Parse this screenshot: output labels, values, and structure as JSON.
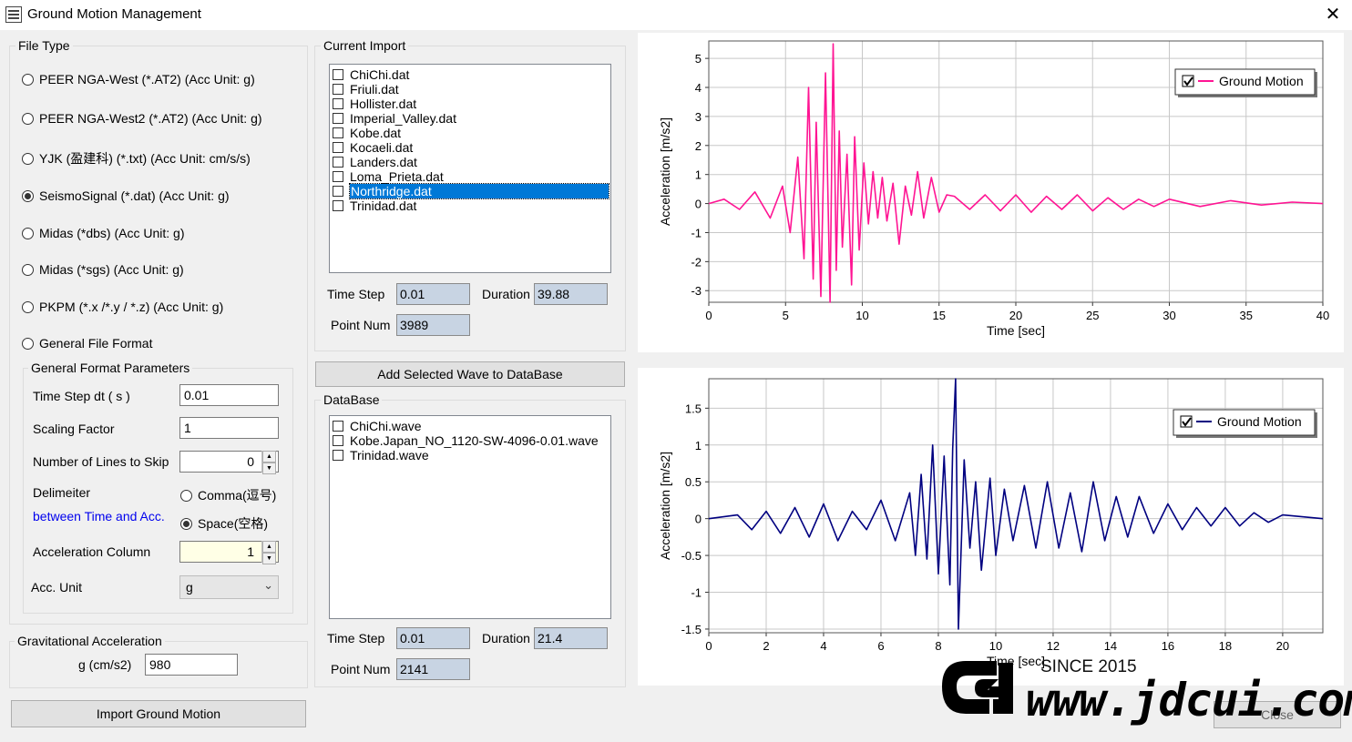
{
  "window": {
    "title": "Ground Motion Management",
    "close_glyph": "✕"
  },
  "file_type": {
    "legend": "File Type",
    "options": [
      {
        "label": "PEER NGA-West (*.AT2) (Acc Unit: g)",
        "checked": false
      },
      {
        "label": "PEER NGA-West2 (*.AT2) (Acc Unit: g)",
        "checked": false
      },
      {
        "label": "YJK (盈建科) (*.txt) (Acc Unit: cm/s/s)",
        "checked": false
      },
      {
        "label": "SeismoSignal (*.dat) (Acc Unit: g)",
        "checked": true
      },
      {
        "label": "Midas (*dbs) (Acc Unit: g)",
        "checked": false
      },
      {
        "label": "Midas (*sgs) (Acc Unit: g)",
        "checked": false
      },
      {
        "label": "PKPM (*.x /*.y / *.z) (Acc Unit: g)",
        "checked": false
      },
      {
        "label": "General File Format",
        "checked": false
      }
    ]
  },
  "general_params": {
    "legend": "General Format Parameters",
    "time_step_label": "Time Step dt ( s )",
    "time_step_value": "0.01",
    "scaling_label": "Scaling Factor",
    "scaling_value": "1",
    "skip_label": "Number of Lines to Skip",
    "skip_value": "0",
    "delimiter_label": "Delimeiter",
    "delimiter_sub": "between Time and Acc.",
    "delimiter_comma": "Comma(逗号)",
    "delimiter_space": "Space(空格)",
    "acc_col_label": "Acceleration Column",
    "acc_col_value": "1",
    "acc_unit_label": "Acc. Unit",
    "acc_unit_value": "g"
  },
  "gravity": {
    "legend": "Gravitational Acceleration",
    "label": "g (cm/s2)",
    "value": "980"
  },
  "import_button": "Import Ground Motion",
  "current_import": {
    "legend": "Current Import",
    "files": [
      "ChiChi.dat",
      "Friuli.dat",
      "Hollister.dat",
      "Imperial_Valley.dat",
      "Kobe.dat",
      "Kocaeli.dat",
      "Landers.dat",
      "Loma_Prieta.dat",
      "Northridge.dat",
      "Trinidad.dat"
    ],
    "selected": "Northridge.dat",
    "time_step_label": "Time Step",
    "time_step": "0.01",
    "duration_label": "Duration",
    "duration": "39.88",
    "point_num_label": "Point Num",
    "point_num": "3989"
  },
  "add_button": "Add Selected Wave to DataBase",
  "database": {
    "legend": "DataBase",
    "files": [
      "ChiChi.wave",
      "Kobe.Japan_NO_1120-SW-4096-0.01.wave",
      "Trinidad.wave"
    ],
    "time_step_label": "Time Step",
    "time_step": "0.01",
    "duration_label": "Duration",
    "duration": "21.4",
    "point_num_label": "Point Num",
    "point_num": "2141"
  },
  "close_button": "Close",
  "watermark": {
    "since": "SINCE 2015",
    "url": "www.jdcui.com"
  },
  "chart_data": [
    {
      "type": "line",
      "xlabel": "Time [sec]",
      "ylabel": "Acceleration [m/s2]",
      "xlim": [
        0,
        40
      ],
      "ylim": [
        -3.4,
        5.6
      ],
      "xticks": [
        0,
        5,
        10,
        15,
        20,
        25,
        30,
        35,
        40
      ],
      "yticks": [
        -3,
        -2,
        -1,
        0,
        1,
        2,
        3,
        4,
        5
      ],
      "grid": true,
      "legend": "top-right",
      "series": [
        {
          "name": "Ground Motion",
          "color": "#ff1493",
          "x": [
            0,
            1,
            2,
            3,
            4,
            4.8,
            5.3,
            5.8,
            6.2,
            6.5,
            6.8,
            7.0,
            7.3,
            7.6,
            7.9,
            8.1,
            8.3,
            8.5,
            8.7,
            9.0,
            9.3,
            9.5,
            9.8,
            10.1,
            10.4,
            10.7,
            11.0,
            11.3,
            11.6,
            12.0,
            12.4,
            12.8,
            13.2,
            13.6,
            14.0,
            14.5,
            15.0,
            15.5,
            16,
            17,
            18,
            19,
            20,
            21,
            22,
            23,
            24,
            25,
            26,
            27,
            28,
            29,
            30,
            32,
            34,
            36,
            38,
            40
          ],
          "y": [
            0,
            0.15,
            -0.2,
            0.4,
            -0.5,
            0.6,
            -1.0,
            1.6,
            -1.9,
            4.0,
            -2.6,
            2.8,
            -3.2,
            4.5,
            -3.4,
            5.5,
            -2.3,
            2.5,
            -1.5,
            1.7,
            -2.8,
            2.3,
            -1.6,
            1.4,
            -0.7,
            1.1,
            -0.5,
            0.9,
            -0.6,
            0.7,
            -1.4,
            0.6,
            -0.4,
            1.1,
            -0.5,
            0.9,
            -0.3,
            0.3,
            0.25,
            -0.2,
            0.3,
            -0.25,
            0.3,
            -0.3,
            0.25,
            -0.2,
            0.3,
            -0.25,
            0.2,
            -0.2,
            0.15,
            -0.1,
            0.15,
            -0.1,
            0.1,
            -0.05,
            0.05,
            0
          ]
        }
      ]
    },
    {
      "type": "line",
      "xlabel": "Time [sec]",
      "ylabel": "Acceleration [m/s2]",
      "xlim": [
        0,
        21.4
      ],
      "ylim": [
        -1.55,
        1.9
      ],
      "xticks": [
        0,
        2,
        4,
        6,
        8,
        10,
        12,
        14,
        16,
        18,
        20
      ],
      "yticks": [
        -1.5,
        -1,
        -0.5,
        0,
        0.5,
        1,
        1.5
      ],
      "grid": true,
      "legend": "top-right",
      "series": [
        {
          "name": "Ground Motion",
          "color": "#000080",
          "x": [
            0,
            1,
            1.5,
            2,
            2.5,
            3,
            3.5,
            4,
            4.5,
            5,
            5.5,
            6,
            6.5,
            7.0,
            7.2,
            7.4,
            7.6,
            7.8,
            8.0,
            8.2,
            8.4,
            8.5,
            8.6,
            8.7,
            8.9,
            9.1,
            9.3,
            9.5,
            9.8,
            10.0,
            10.3,
            10.6,
            11.0,
            11.4,
            11.8,
            12.2,
            12.6,
            13.0,
            13.4,
            13.8,
            14.2,
            14.6,
            15.0,
            15.5,
            16,
            16.5,
            17,
            17.5,
            18,
            18.5,
            19,
            19.5,
            20,
            21.4
          ],
          "y": [
            0,
            0.05,
            -0.15,
            0.1,
            -0.2,
            0.15,
            -0.25,
            0.2,
            -0.3,
            0.1,
            -0.15,
            0.25,
            -0.3,
            0.35,
            -0.5,
            0.6,
            -0.55,
            1.0,
            -0.75,
            0.85,
            -0.9,
            0.95,
            1.9,
            -1.5,
            0.8,
            -0.4,
            0.5,
            -0.7,
            0.55,
            -0.5,
            0.4,
            -0.3,
            0.45,
            -0.4,
            0.5,
            -0.4,
            0.35,
            -0.45,
            0.5,
            -0.3,
            0.3,
            -0.25,
            0.3,
            -0.2,
            0.2,
            -0.15,
            0.15,
            -0.1,
            0.15,
            -0.1,
            0.08,
            -0.05,
            0.05,
            0
          ]
        }
      ]
    }
  ]
}
